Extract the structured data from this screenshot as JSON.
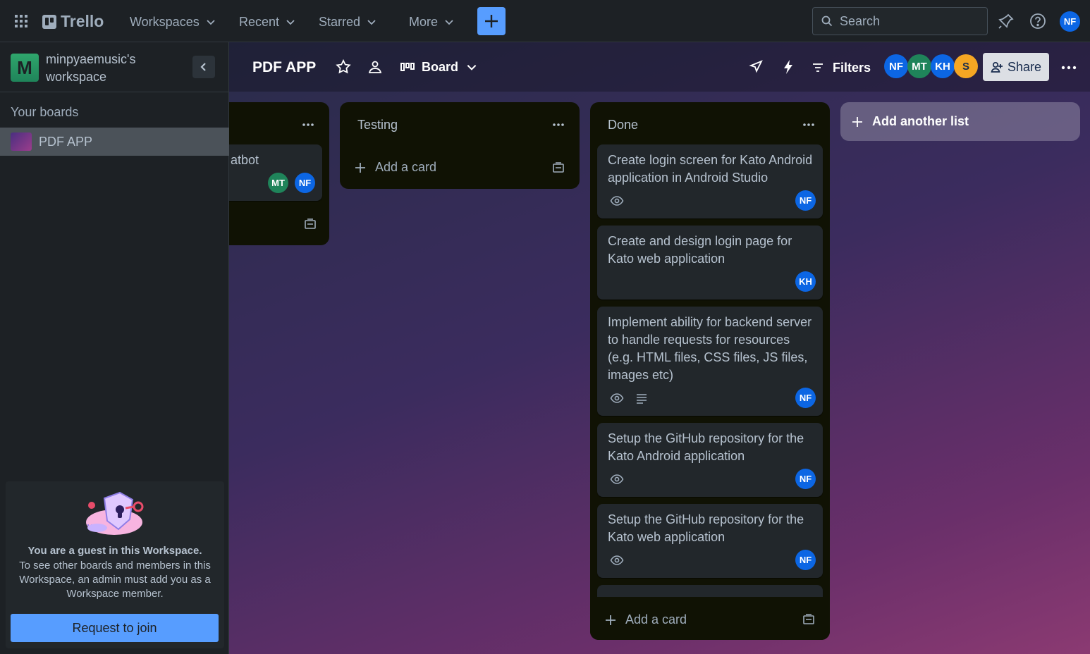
{
  "topnav": {
    "logo": "Trello",
    "menus": [
      "Workspaces",
      "Recent",
      "Starred",
      "More"
    ],
    "search_placeholder": "Search",
    "user_initials": "NF"
  },
  "sidebar": {
    "workspace_initial": "M",
    "workspace_name": "minpyaemusic's workspace",
    "your_boards": "Your boards",
    "boards": [
      "PDF APP"
    ],
    "guest_title": "You are a guest in this Workspace.",
    "guest_text": "To see other boards and members in this Workspace, an admin must add you as a Workspace member.",
    "join_button": "Request to join"
  },
  "board": {
    "title": "PDF APP",
    "view": "Board",
    "filters": "Filters",
    "share": "Share",
    "members": [
      {
        "initials": "NF",
        "color": "#0c66e4"
      },
      {
        "initials": "MT",
        "color": "#1f845a"
      },
      {
        "initials": "KH",
        "color": "#0c66e4"
      },
      {
        "initials": "S",
        "color": "#f5a623"
      }
    ],
    "add_list": "Add another list"
  },
  "lists": [
    {
      "title": "",
      "cards": [
        {
          "text": "atbot",
          "members": [
            "MT",
            "NF"
          ]
        }
      ]
    },
    {
      "title": "Testing",
      "add_card": "Add a card"
    },
    {
      "title": "Done",
      "add_card": "Add a card",
      "cards": [
        {
          "text": "Create login screen for Kato Android application in Android Studio",
          "member": "NF"
        },
        {
          "text": "Create and design login page for Kato web application",
          "member": "KH"
        },
        {
          "text": "Implement ability for backend server to handle requests for resources (e.g. HTML files, CSS files, JS files, images etc)",
          "member": "NF"
        },
        {
          "text": "Setup the GitHub repository for the Kato Android application",
          "member": "NF"
        },
        {
          "text": "Setup the GitHub repository for the Kato web application",
          "member": "NF"
        }
      ]
    }
  ],
  "colors": {
    "accent": "#579dff",
    "nav_bg": "#1d2125",
    "list_bg": "#101204",
    "card_bg": "#22272b"
  }
}
